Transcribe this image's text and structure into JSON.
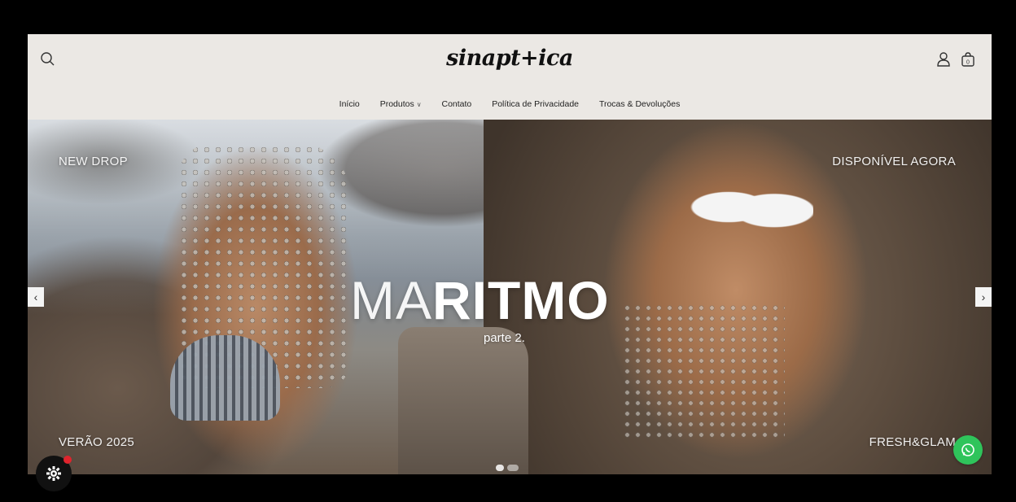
{
  "header": {
    "logo_text": "sinapt+ica",
    "icons": {
      "search": "search-icon",
      "account": "user-icon",
      "cart": "shopping-bag-icon"
    },
    "cart_count": "0"
  },
  "nav": {
    "items": [
      {
        "label": "Início"
      },
      {
        "label": "Produtos"
      },
      {
        "label": "Contato"
      },
      {
        "label": "Política de Privacidade"
      },
      {
        "label": "Trocas & Devoluções"
      }
    ]
  },
  "hero": {
    "corner_top_left": "NEW DROP",
    "corner_top_right": "DISPONÍVEL AGORA",
    "corner_bottom_left": "VERÃO 2025",
    "corner_bottom_right": "FRESH&GLAM",
    "title_light": "MA",
    "title_bold": "RITMO",
    "subtitle": "parte 2."
  },
  "colors": {
    "header_bg": "#ebe8e4",
    "whatsapp": "#2fc45b",
    "badge": "#e0242d"
  }
}
